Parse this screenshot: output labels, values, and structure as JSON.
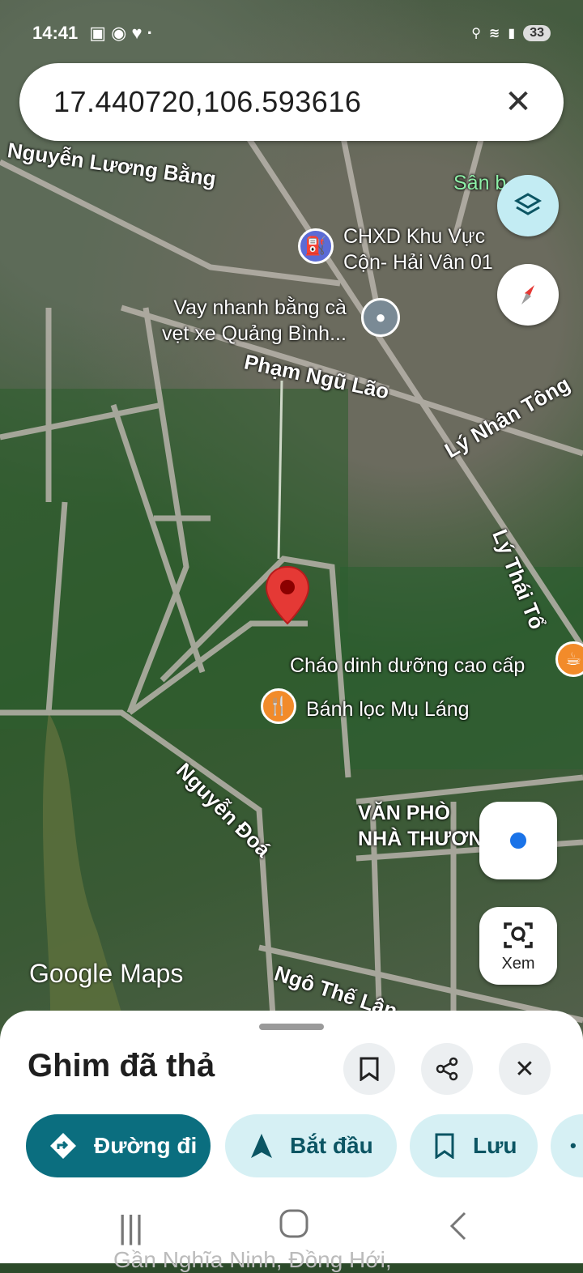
{
  "status_bar": {
    "time": "14:41",
    "battery": "33"
  },
  "search": {
    "value": "17.440720,106.593616"
  },
  "map": {
    "streets": [
      "Nguyễn Lương Bằng",
      "Phạm Ngũ Lão",
      "Lý Nhân Tông",
      "Lý Thái Tổ",
      "Nguyễn Đoá",
      "Ngô Thế Lân"
    ],
    "pois": [
      {
        "name": "CHXD Khu Vực\nCộn- Hải Vân 01",
        "icon": "gas-station-icon"
      },
      {
        "name": "Vay nhanh bằng cà\nvẹt xe Quảng Bình...",
        "icon": "place-icon"
      },
      {
        "name": "Cháo dinh dưỡng cao cấp",
        "icon": "cafe-icon"
      },
      {
        "name": "Bánh lọc Mụ Láng",
        "icon": "restaurant-icon"
      },
      {
        "name": "VĂN PHÒ\nNHÀ THƯƠN",
        "icon": ""
      },
      {
        "name": "Sân b",
        "icon": ""
      }
    ],
    "attribution": "Google Maps",
    "pin_color": "#e53935"
  },
  "controls": {
    "view_label": "Xem"
  },
  "sheet": {
    "title": "Ghim đã thả",
    "chips": [
      {
        "label": "Đường đi",
        "icon": "directions-icon"
      },
      {
        "label": "Bắt đầu",
        "icon": "navigation-arrow-icon"
      },
      {
        "label": "Lưu",
        "icon": "bookmark-icon"
      }
    ],
    "address": "Gần Nghĩa Ninh, Đồng Hới,"
  },
  "colors": {
    "primary_chip": "#0b6e7f",
    "secondary_chip": "#d6f0f4",
    "chip_text_dark": "#0b5563"
  }
}
